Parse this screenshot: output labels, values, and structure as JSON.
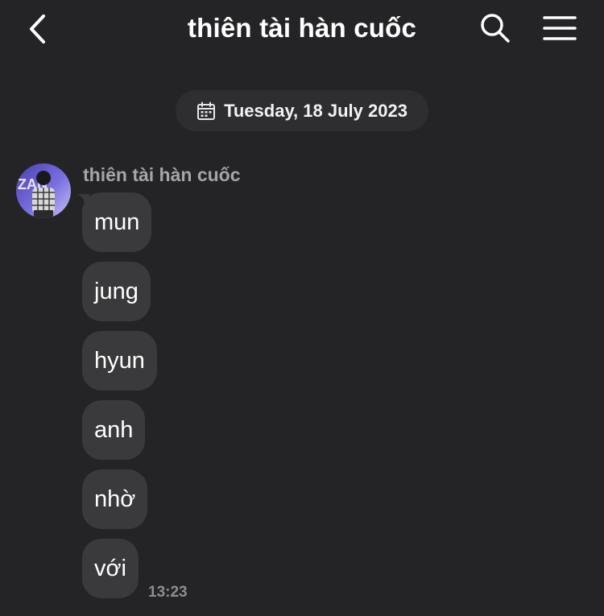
{
  "header": {
    "title": "thiên tài hàn cuốc",
    "back_icon": "chevron-left-icon",
    "search_icon": "search-icon",
    "menu_icon": "hamburger-menu-icon"
  },
  "date_separator": {
    "icon": "calendar-icon",
    "label": "Tuesday, 18 July 2023"
  },
  "conversation": {
    "sender_name": "thiên tài hàn cuốc",
    "messages": [
      {
        "text": "mun"
      },
      {
        "text": "jung"
      },
      {
        "text": "hyun"
      },
      {
        "text": "anh"
      },
      {
        "text": "nhờ"
      },
      {
        "text": "với"
      }
    ],
    "last_time": "13:23"
  },
  "colors": {
    "background": "#242426",
    "bubble": "#3a3a3c",
    "pill": "#2e2e30",
    "secondary_text": "#a6a6a8"
  }
}
